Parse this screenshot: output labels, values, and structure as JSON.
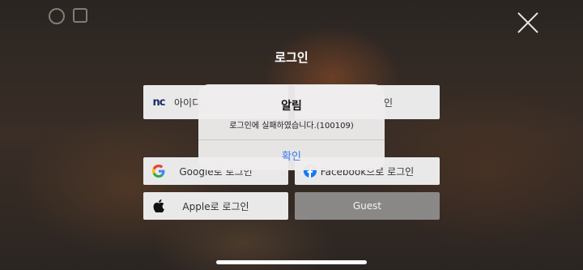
{
  "screen": {
    "title": "로그인"
  },
  "buttons": {
    "nc_label": "아이디,",
    "nc_icon_text": "nc",
    "nc_right_label": "인",
    "google_label": "Google로 로그인",
    "facebook_label": "Facebook으로 로그인",
    "apple_label": "Apple로 로그인",
    "guest_label": "Guest"
  },
  "alert": {
    "title": "알림",
    "message": "로그인에 실패하였습니다.(100109)",
    "confirm": "확인"
  },
  "colors": {
    "alert_button": "#2f7bf5",
    "google_blue": "#4285F4",
    "facebook_blue": "#1877F2"
  }
}
